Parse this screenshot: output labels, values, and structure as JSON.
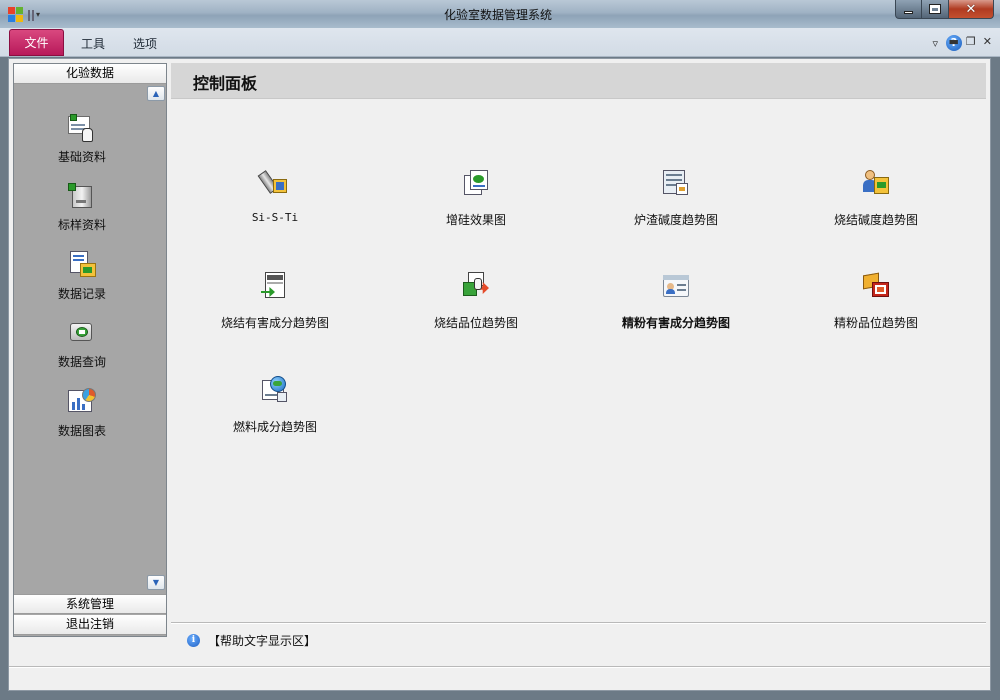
{
  "window": {
    "title": "化验室数据管理系统"
  },
  "ribbon": {
    "tabs": [
      "文件",
      "工具",
      "选项"
    ]
  },
  "sidebar": {
    "group_title": "化验数据",
    "items": [
      {
        "label": "基础资料",
        "icon": "basic-data-icon"
      },
      {
        "label": "标样资料",
        "icon": "standard-sample-icon"
      },
      {
        "label": "数据记录",
        "icon": "data-record-icon"
      },
      {
        "label": "数据查询",
        "icon": "data-query-icon"
      },
      {
        "label": "数据图表",
        "icon": "data-chart-icon"
      }
    ],
    "bottom_groups": [
      "系统管理",
      "退出注销"
    ]
  },
  "panel": {
    "title": "控制面板",
    "items": [
      {
        "label": "Si-S-Ti",
        "icon": "si-s-ti-icon"
      },
      {
        "label": "增硅效果图",
        "icon": "silicon-effect-icon"
      },
      {
        "label": "炉渣碱度趋势图",
        "icon": "slag-basicity-icon"
      },
      {
        "label": "烧结碱度趋势图",
        "icon": "sinter-basicity-icon"
      },
      {
        "label": "烧结有害成分趋势图",
        "icon": "sinter-harmful-icon"
      },
      {
        "label": "烧结品位趋势图",
        "icon": "sinter-grade-icon"
      },
      {
        "label": "精粉有害成分趋势图",
        "icon": "concentrate-harmful-icon"
      },
      {
        "label": "精粉品位趋势图",
        "icon": "concentrate-grade-icon"
      },
      {
        "label": "燃料成分趋势图",
        "icon": "fuel-composition-icon"
      }
    ]
  },
  "help": {
    "text": "【帮助文字显示区】"
  },
  "colors": {
    "file_tab": "#b8195a",
    "sidebar_bg": "#a6a6a6",
    "panel_bg": "#f0f0f0"
  }
}
